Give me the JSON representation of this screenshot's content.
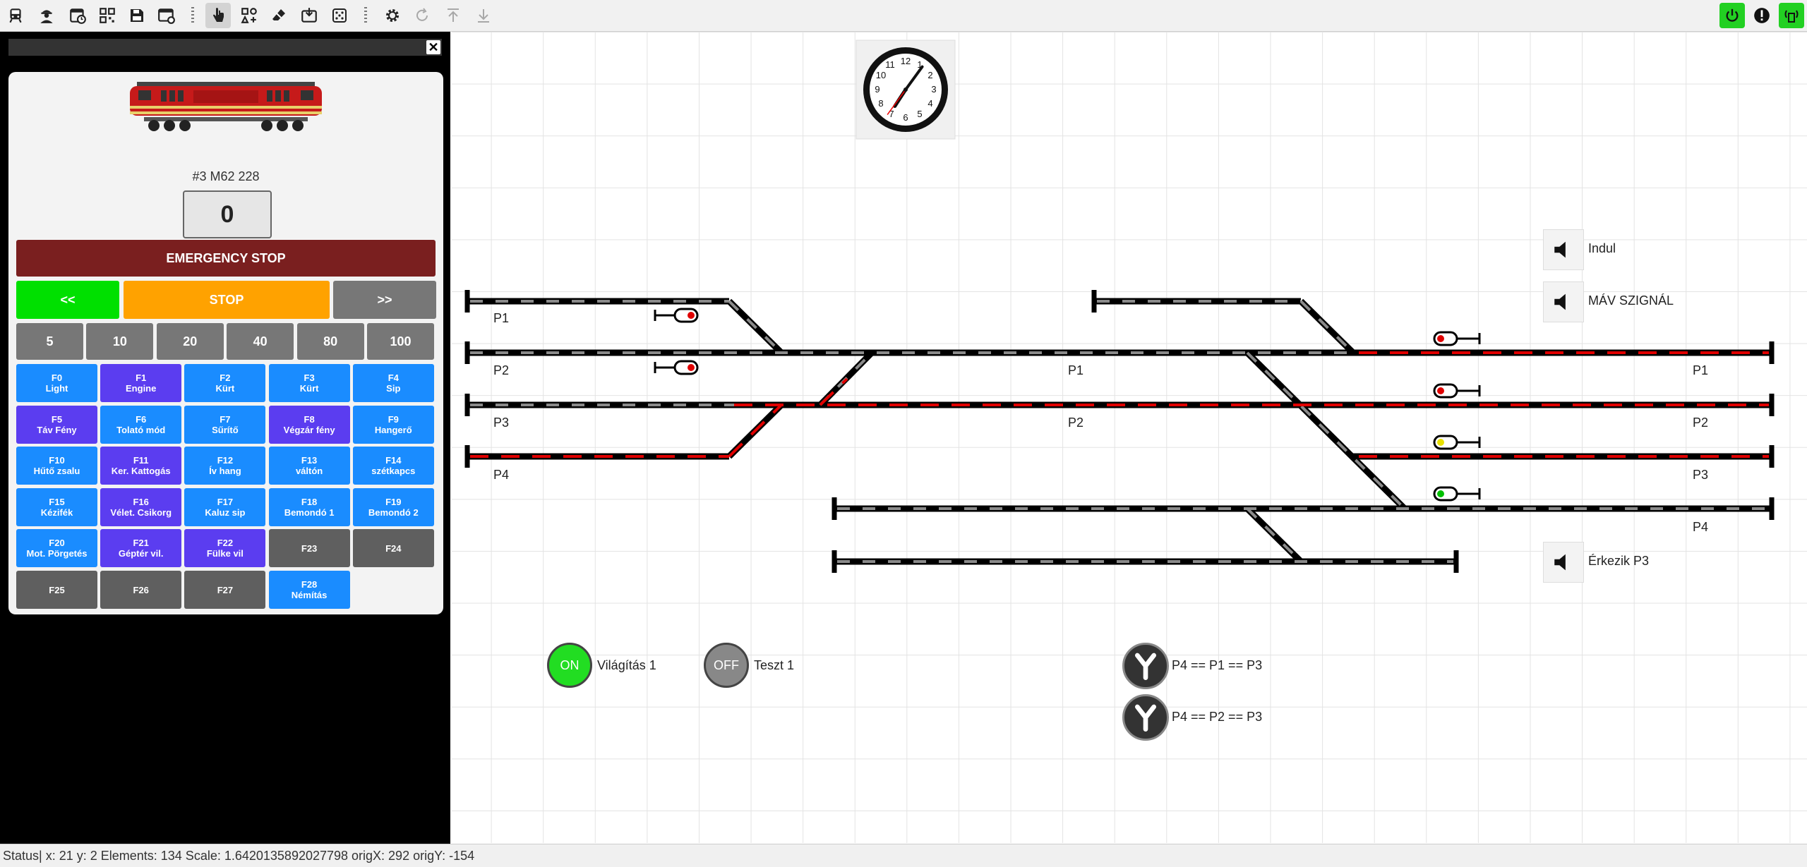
{
  "toolbar": {
    "left_icons": [
      "train-icon",
      "engineer-icon",
      "calendar-clock-icon",
      "qr-code-icon",
      "save-icon",
      "settings-window-icon",
      "hand-pointer-icon",
      "add-elements-icon",
      "eraser-icon",
      "import-icon",
      "dice-icon",
      "gear-icon",
      "refresh-icon",
      "upload-icon",
      "download-icon"
    ],
    "right_icons": [
      "power-icon",
      "alert-icon",
      "wireless-icon"
    ]
  },
  "locomotive": {
    "name": "#3 M62 228",
    "speed": "0",
    "emergency_label": "EMERGENCY STOP",
    "reverse_label": "<<",
    "stop_label": "STOP",
    "forward_label": ">>",
    "speed_steps": [
      "5",
      "10",
      "20",
      "40",
      "80",
      "100"
    ],
    "functions": [
      {
        "key": "F0",
        "name": "Light"
      },
      {
        "key": "F1",
        "name": "Engine"
      },
      {
        "key": "F2",
        "name": "Kürt"
      },
      {
        "key": "F3",
        "name": "Kürt"
      },
      {
        "key": "F4",
        "name": "Sip"
      },
      {
        "key": "F5",
        "name": "Táv Fény"
      },
      {
        "key": "F6",
        "name": "Tolató mód"
      },
      {
        "key": "F7",
        "name": "Sűrítő"
      },
      {
        "key": "F8",
        "name": "Végzár fény"
      },
      {
        "key": "F9",
        "name": "Hangerő"
      },
      {
        "key": "F10",
        "name": "Hűtő zsalu"
      },
      {
        "key": "F11",
        "name": "Ker. Kattogás"
      },
      {
        "key": "F12",
        "name": "Ív hang"
      },
      {
        "key": "F13",
        "name": "váltón"
      },
      {
        "key": "F14",
        "name": "szétkapcs"
      },
      {
        "key": "F15",
        "name": "Kézifék"
      },
      {
        "key": "F16",
        "name": "Vélet. Csikorg"
      },
      {
        "key": "F17",
        "name": "Kaluz sip"
      },
      {
        "key": "F18",
        "name": "Bemondó 1"
      },
      {
        "key": "F19",
        "name": "Bemondó 2"
      },
      {
        "key": "F20",
        "name": "Mot. Pörgetés"
      },
      {
        "key": "F21",
        "name": "Géptér vil."
      },
      {
        "key": "F22",
        "name": "Fülke vil"
      },
      {
        "key": "F23",
        "name": ""
      },
      {
        "key": "F24",
        "name": ""
      },
      {
        "key": "F25",
        "name": ""
      },
      {
        "key": "F26",
        "name": ""
      },
      {
        "key": "F27",
        "name": ""
      },
      {
        "key": "F28",
        "name": "Némítás"
      }
    ]
  },
  "clock": {
    "hour": 7,
    "minute": 6,
    "second": 36
  },
  "track_labels": {
    "left_p1": "P1",
    "left_p2": "P2",
    "left_p3": "P3",
    "left_p4": "P4",
    "mid_p1": "P1",
    "mid_p2": "P2",
    "right_p1": "P1",
    "right_p2": "P2",
    "right_p3": "P3",
    "right_p4": "P4"
  },
  "sounds": {
    "indul": "Indul",
    "mav": "MÁV SZIGNÁL",
    "erkezik": "Érkezik P3"
  },
  "switches": {
    "lighting": {
      "state": "ON",
      "label": "Világítás 1"
    },
    "test": {
      "state": "OFF",
      "label": "Teszt 1"
    }
  },
  "routes": [
    "P4 == P1 == P3",
    "P4 == P2 == P3"
  ],
  "colors": {
    "active_green": "#00e000",
    "occupied_red": "#e00000",
    "emergency": "#7a1f1f",
    "stop_orange": "#ffa200"
  },
  "status": "Status| x: 21 y: 2 Elements: 134 Scale: 1.6420135892027798 origX: 292 origY: -154"
}
